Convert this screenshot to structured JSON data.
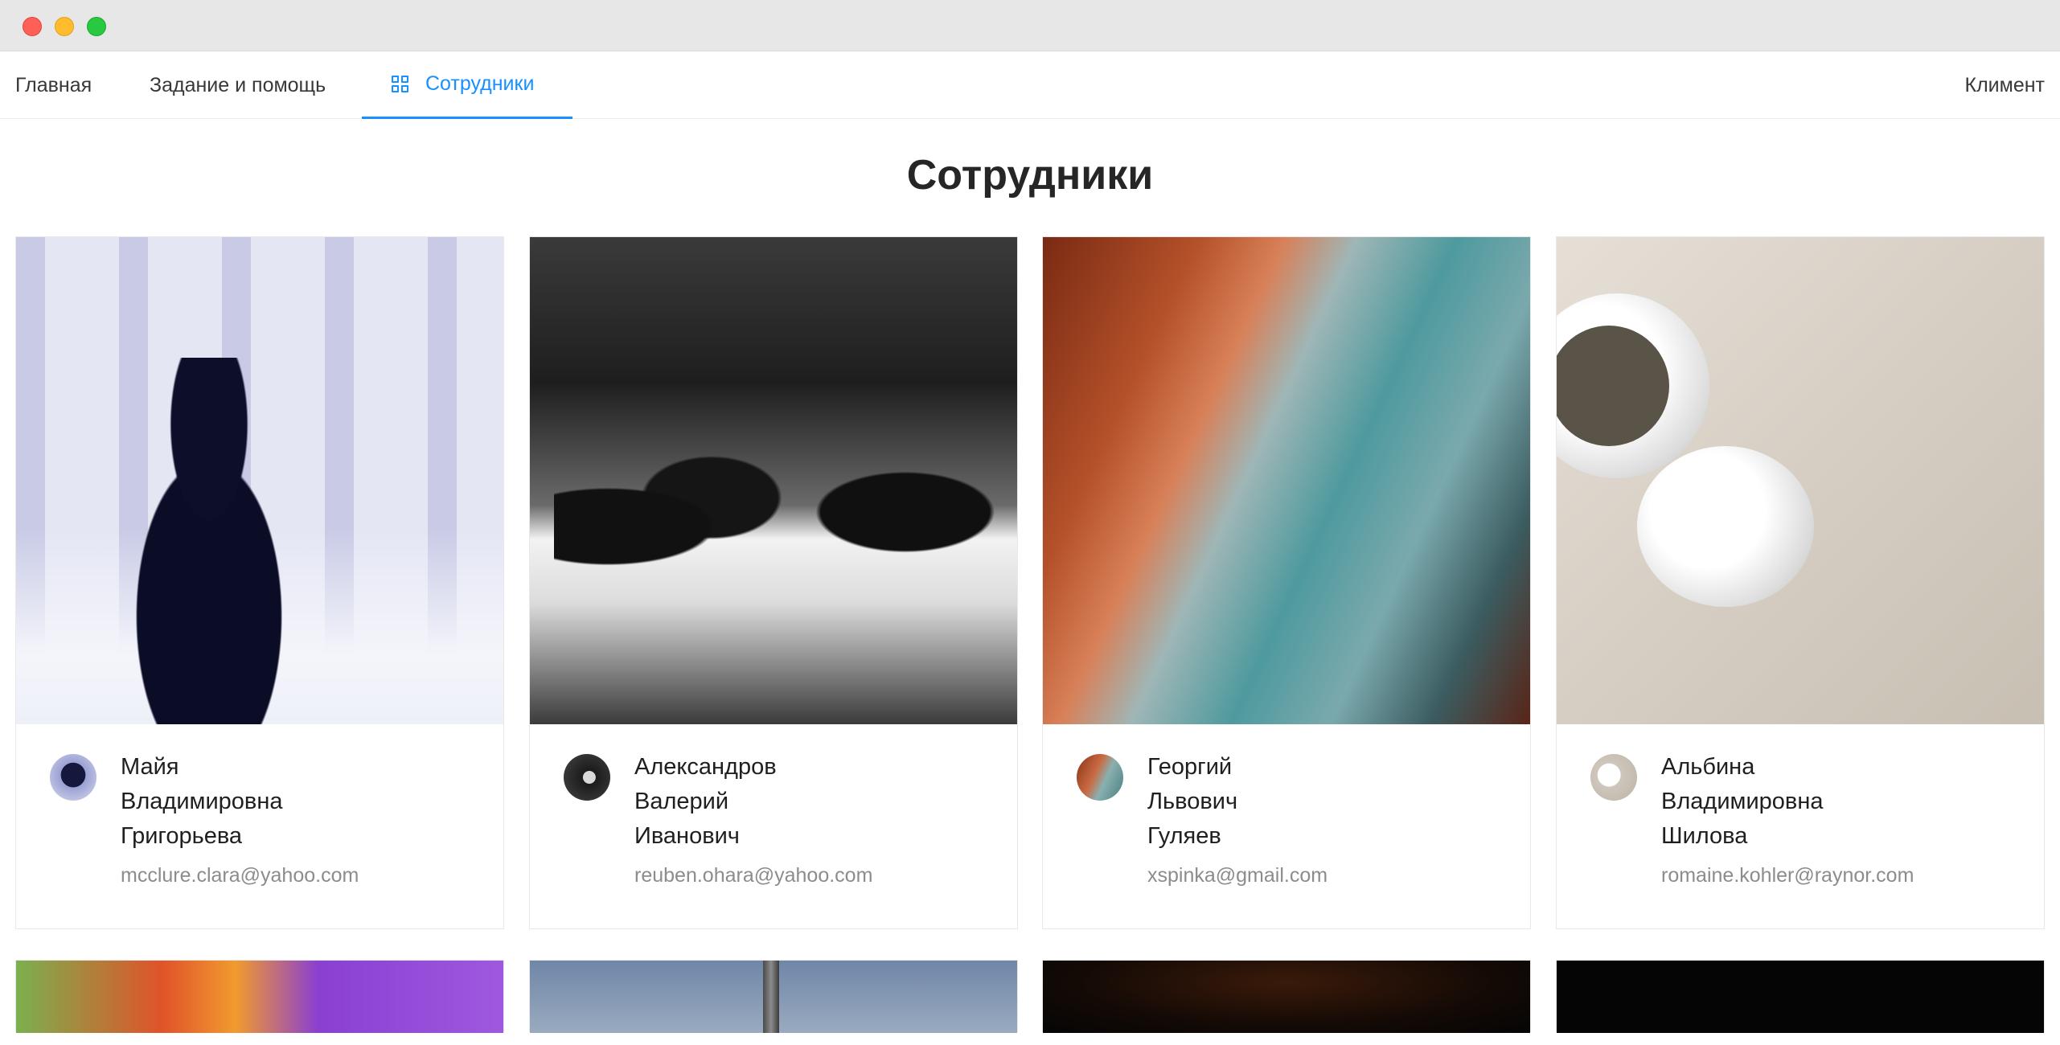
{
  "nav": {
    "home_label": "Главная",
    "help_label": "Задание и помощь",
    "staff_label": "Сотрудники",
    "user_label": "Климент"
  },
  "page": {
    "title": "Сотрудники"
  },
  "employees": [
    {
      "name_line1": "Майя",
      "name_line2": "Владимировна",
      "name_line3": "Григорьева",
      "email": "mcclure.clara@yahoo.com",
      "cover": "bartender-photo"
    },
    {
      "name_line1": "Александров",
      "name_line2": "Валерий",
      "name_line3": "Иванович",
      "email": "reuben.ohara@yahoo.com",
      "cover": "party-bar-photo"
    },
    {
      "name_line1": "Георгий",
      "name_line2": "Львович",
      "name_line3": "Гуляев",
      "email": "xspinka@gmail.com",
      "cover": "rocky-sea-photo"
    },
    {
      "name_line1": "Альбина",
      "name_line2": "Владимировна",
      "name_line3": "Шилова",
      "email": "romaine.kohler@raynor.com",
      "cover": "earphones-photo"
    }
  ],
  "icons": {
    "staff_tab_icon": "appstore-grid-icon"
  },
  "colors": {
    "accent": "#1890ff",
    "titlebar": "#e7e7e7",
    "text": "#262626",
    "muted": "#8c8c8c"
  }
}
